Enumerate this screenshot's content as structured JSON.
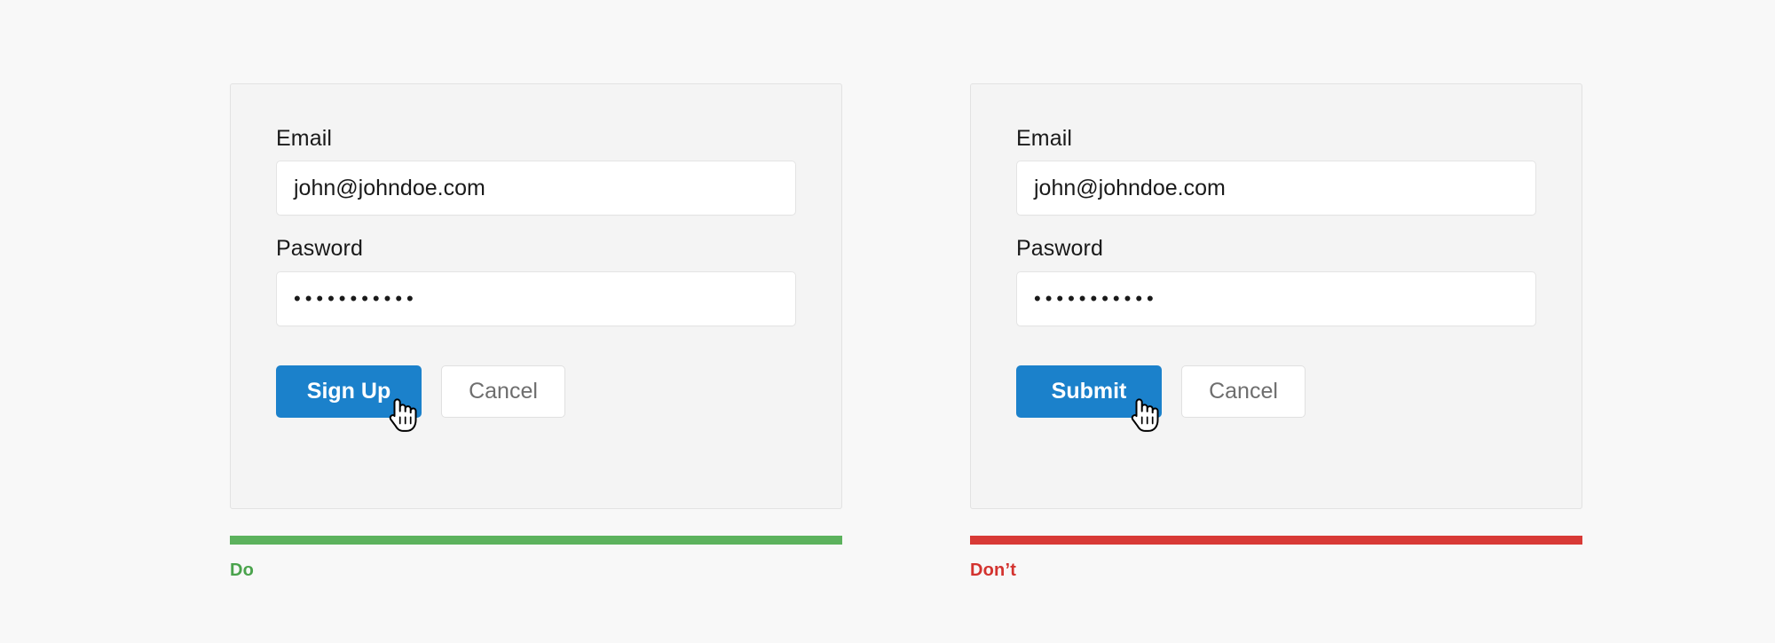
{
  "page": {
    "background_color": "#f8f8f8"
  },
  "colors": {
    "primary_blue": "#1b81cb",
    "do_green": "#5cb25d",
    "dont_red": "#d83a36",
    "card_background": "#f4f4f4",
    "card_border": "#e2e2e2",
    "input_background": "#ffffff",
    "secondary_text": "#6e6e6e"
  },
  "examples": [
    {
      "id": "do-example",
      "verdict": "Do",
      "form": {
        "email_label": "Email",
        "email_value": "john@johndoe.com",
        "email_placeholder": "Email",
        "password_label": "Pasword",
        "password_value": "•••••••••••",
        "password_placeholder": "Pasword",
        "password_char_count": 11,
        "primary_button": "Sign Up",
        "secondary_button": "Cancel"
      }
    },
    {
      "id": "dont-example",
      "verdict": "Don’t",
      "form": {
        "email_label": "Email",
        "email_value": "john@johndoe.com",
        "email_placeholder": "Email",
        "password_label": "Pasword",
        "password_value": "•••••••••••",
        "password_placeholder": "Pasword",
        "password_char_count": 11,
        "primary_button": "Submit",
        "secondary_button": "Cancel"
      }
    }
  ]
}
